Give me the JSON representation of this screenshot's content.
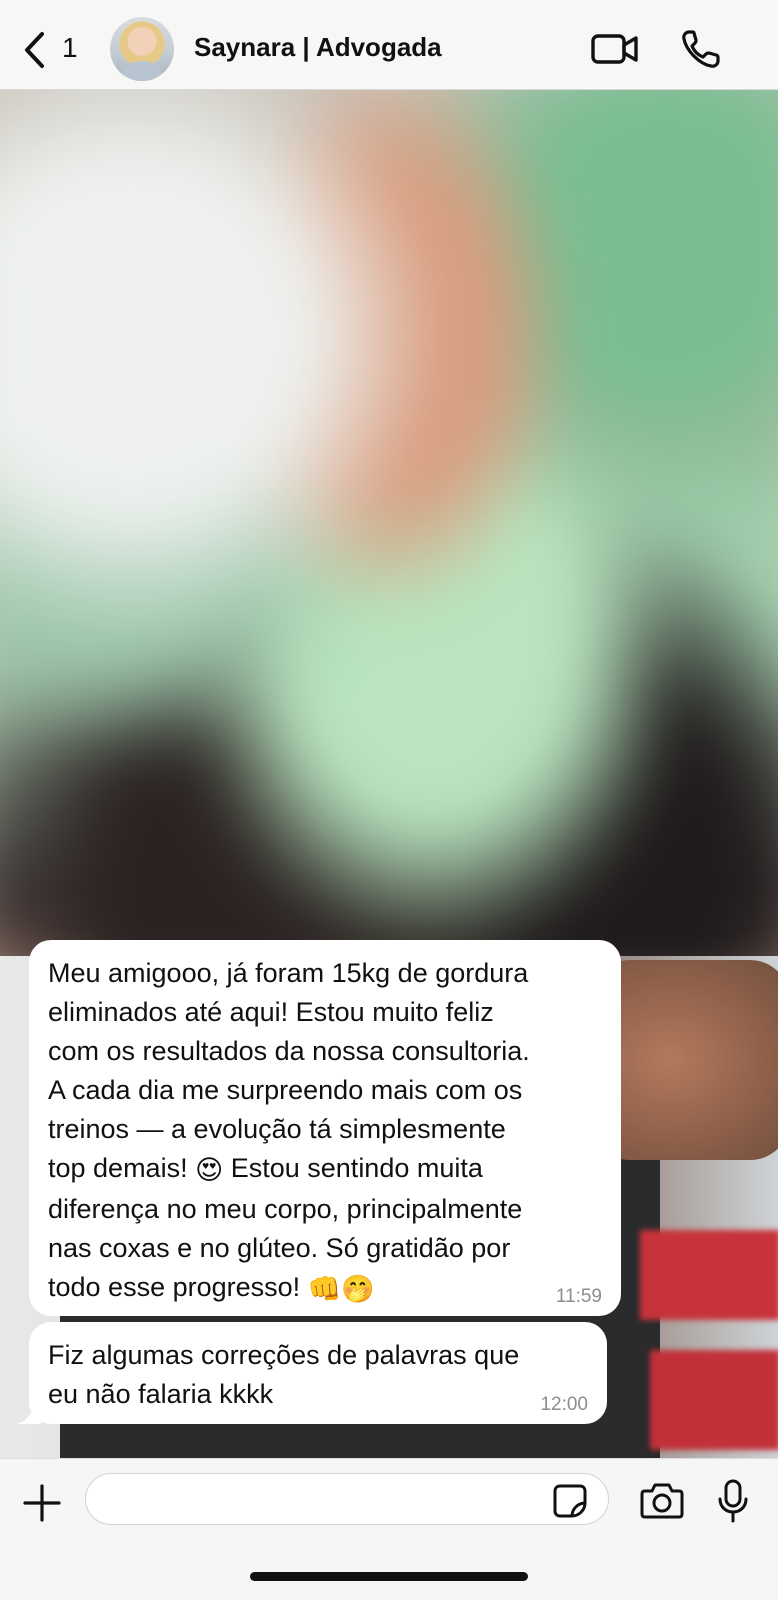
{
  "header": {
    "back_count": "1",
    "contact_name": "Saynara | Advogada"
  },
  "messages": [
    {
      "text_lines": [
        "Meu amigooo, já foram 15kg de gordura",
        "eliminados até aqui! Estou muito feliz",
        "com os resultados da nossa consultoria.",
        "A cada dia me surpreendo mais com os",
        "treinos — a evolução tá simplesmente",
        "top demais! "
      ],
      "line6_emoji": "😍",
      "line6_rest": " Estou sentindo muita",
      "line7": "diferença no meu corpo, principalmente",
      "line8": "nas coxas e no glúteo. Só gratidão por",
      "line9": "todo esse progresso! ",
      "end_emojis": "👊🤭",
      "time": "11:59"
    },
    {
      "text": "Fiz algumas correções de palavras que\neu não falaria kkkk",
      "time": "12:00"
    }
  ],
  "composer": {
    "input_value": "",
    "input_placeholder": ""
  },
  "icons": {
    "back": "chevron-left-icon",
    "video": "video-call-icon",
    "call": "phone-icon",
    "plus": "plus-icon",
    "sticker": "sticker-icon",
    "camera": "camera-icon",
    "mic": "microphone-icon"
  }
}
